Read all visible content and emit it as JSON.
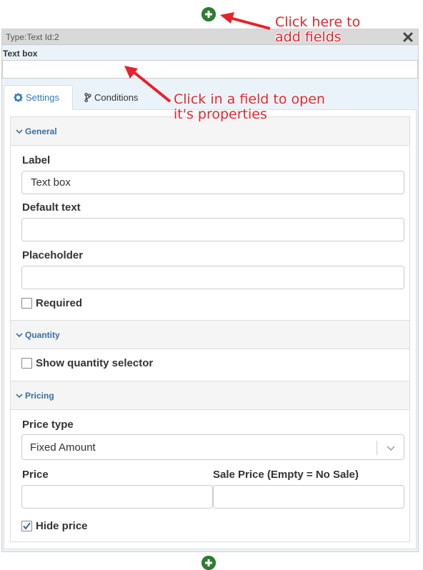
{
  "panel": {
    "title": "Type:Text Id:2",
    "field_label": "Text box"
  },
  "tabs": [
    {
      "label": "Settings",
      "icon": "gear-icon",
      "active": true
    },
    {
      "label": "Conditions",
      "icon": "branch-icon",
      "active": false
    }
  ],
  "general": {
    "heading": "General",
    "label_label": "Label",
    "label_value": "Text box",
    "default_text_label": "Default text",
    "default_text_value": "",
    "placeholder_label": "Placeholder",
    "placeholder_value": "",
    "required_label": "Required",
    "required_checked": false
  },
  "quantity": {
    "heading": "Quantity",
    "show_selector_label": "Show quantity selector",
    "show_selector_checked": false
  },
  "pricing": {
    "heading": "Pricing",
    "price_type_label": "Price type",
    "price_type_value": "Fixed Amount",
    "price_label": "Price",
    "price_value": "",
    "sale_price_label": "Sale Price (Empty = No Sale)",
    "sale_price_value": "",
    "hide_price_label": "Hide price",
    "hide_price_checked": true
  },
  "annotations": {
    "add_fields_line1": "Click here to",
    "add_fields_line2": "add fields",
    "open_props_line1": "Click in a field to open",
    "open_props_line2": "it's properties"
  },
  "colors": {
    "accent_blue": "#337ab7",
    "add_green": "#2e7d32",
    "annotation_red": "#e8212b"
  }
}
